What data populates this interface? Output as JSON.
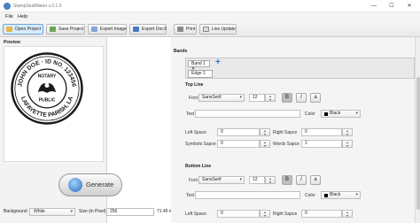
{
  "window": {
    "title": "StampSealMaker v.2.1.0",
    "minimize": "—",
    "maximize": "☐",
    "close": "✕"
  },
  "menu": {
    "file": "File",
    "help": "Help"
  },
  "toolbar": {
    "open_project": "Open Project",
    "save_project": "Save Project",
    "export_image": "Export Image",
    "export_docx": "Export DocX",
    "print": "Print",
    "live_update": "Live Update"
  },
  "preview": {
    "label": "Preview",
    "stamp_top_text": "JOHN DOE · ID NO. 123456",
    "stamp_bottom_text": "LAFAYETTE PARISH, LA",
    "stamp_center_top": "NOTARY",
    "stamp_center_bottom": "PUBLIC",
    "generate_label": "Generate"
  },
  "bottom_bar": {
    "background_label": "Background",
    "background_value": "White",
    "size_label": "Size (in Pixel)",
    "size_value": "256",
    "size_mm": "71.45 mm"
  },
  "bands": {
    "title": "Bands",
    "band_tab": "Band 1 ✕",
    "add_icon": "+",
    "edge_tab": "Edge 1"
  },
  "top_line": {
    "title": "Top Line",
    "font_label": "Font",
    "font_value": "SansSerif",
    "size_value": "12",
    "text_label": "Text",
    "text_value": "",
    "color_label": "Color",
    "color_value": "Black",
    "left_space_label": "Left Space",
    "left_space_value": "0",
    "right_space_label": "Right Sapce",
    "right_space_value": "0",
    "symbols_space_label": "Symbols Sapce",
    "symbols_space_value": "0",
    "words_space_label": "Words Sapce",
    "words_space_value": "1"
  },
  "bottom_line": {
    "title": "Bottom Line",
    "font_label": "Font",
    "font_value": "SansSerif",
    "size_value": "12",
    "text_label": "Text",
    "text_value": "",
    "color_label": "Color",
    "color_value": "Black",
    "left_space_label": "Left Space",
    "left_space_value": "0",
    "right_space_label": "Right Sapce",
    "right_space_value": "0"
  },
  "style_buttons": {
    "bold": "B",
    "italic": "I",
    "outline": "a"
  },
  "colors": {
    "accent": "#2d76c7",
    "active_toolbar": "#d9ecff",
    "stamp_ink": "#1a1a1a"
  }
}
